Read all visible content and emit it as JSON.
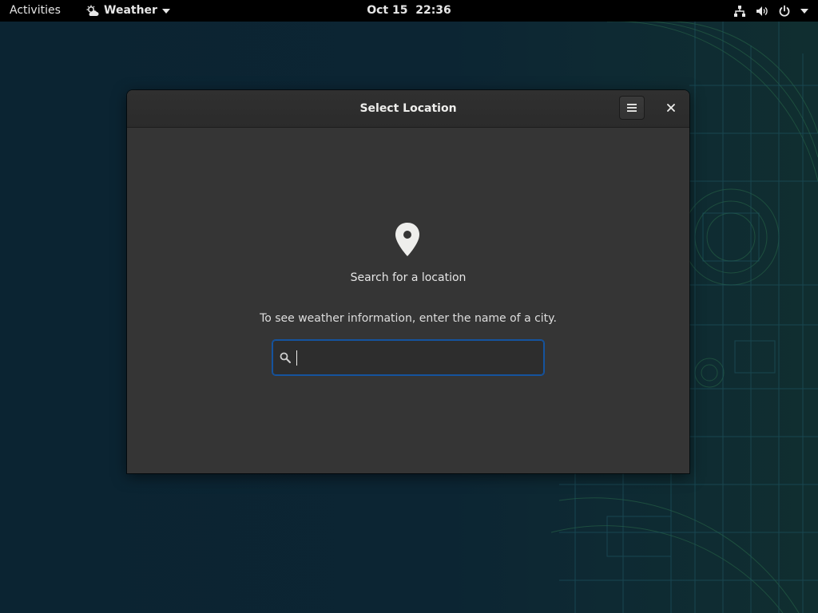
{
  "topbar": {
    "activities": "Activities",
    "app_name": "Weather",
    "clock": "Oct 15  22:36"
  },
  "window": {
    "title": "Select Location",
    "close_glyph": "×"
  },
  "content": {
    "heading": "Search for a location",
    "description": "To see weather information, enter the name of a city.",
    "search_value": "",
    "search_placeholder": ""
  },
  "icons": {
    "app": "weather-few-clouds-icon",
    "menu": "hamburger-menu-icon",
    "close": "close-icon",
    "location": "map-pin-icon",
    "search": "search-icon",
    "network": "network-icon",
    "volume": "volume-icon",
    "power": "power-icon"
  },
  "colors": {
    "accent": "#15539e",
    "window_bg": "#353535",
    "topbar_bg": "#000000"
  }
}
